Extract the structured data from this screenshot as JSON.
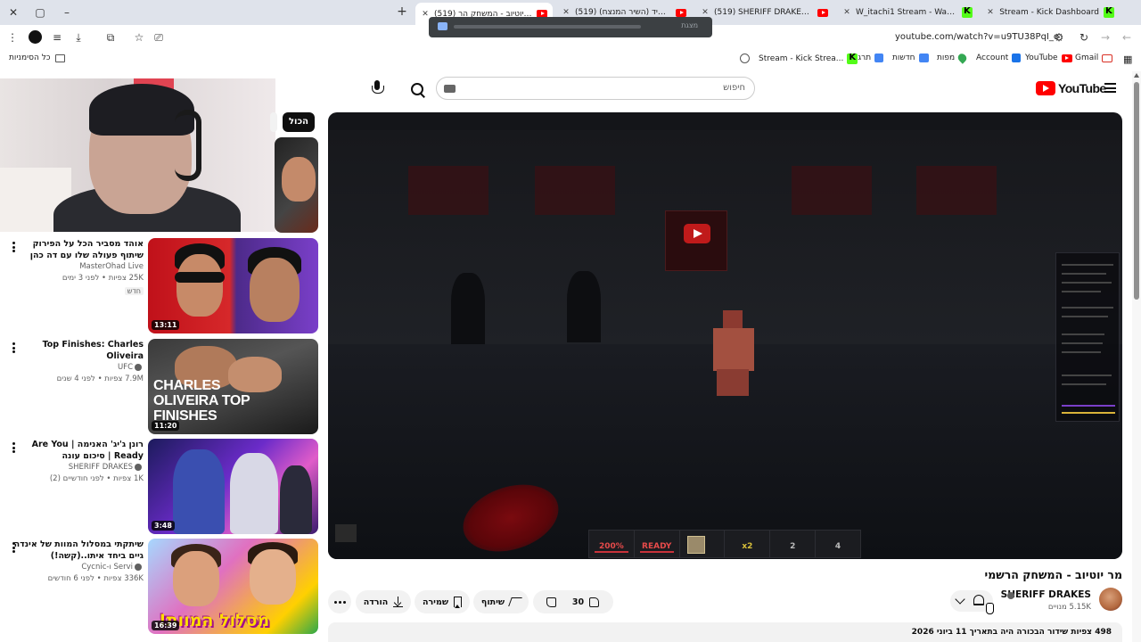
{
  "browser": {
    "tabs": [
      {
        "label": "Stream - Kick Dashboard",
        "favicon": "kick"
      },
      {
        "label": "W_itachi1 Stream - Watch Live",
        "favicon": "kick"
      },
      {
        "label": "(519) SHERIFF DRAKES - YouTube",
        "favicon": "youtube"
      },
      {
        "label": "(519) תפרוש מיד (השיר המנצח)",
        "favicon": "youtube"
      },
      {
        "label": "(519) מר יוטיוב - המשחק הר",
        "favicon": "youtube",
        "active": true
      }
    ],
    "url": "youtube.com/watch?v=u9TU38PqI_o",
    "popup_text": "מצגת"
  },
  "bookmarks": {
    "all_label": "כל הסימניות",
    "items": [
      {
        "label": "Gmail",
        "icon": "gmail-icon"
      },
      {
        "label": "YouTube",
        "icon": "youtube-icon"
      },
      {
        "label": "Account",
        "icon": "account-icon"
      },
      {
        "label": "מפות",
        "icon": "maps-icon"
      },
      {
        "label": "חדשות",
        "icon": "news-icon"
      },
      {
        "label": "תרגום",
        "icon": "translate-icon"
      },
      {
        "label": "Stream - Kick Strea...",
        "icon": "kick-icon"
      }
    ]
  },
  "youtube": {
    "logo_text": "YouTube",
    "search_placeholder": "חיפוש",
    "chips": [
      "הכול"
    ],
    "recommendations": [
      {
        "title": "אוהד מסביר הכל על הפירוק שיתוף פעולה שלו עם דה כהן",
        "channel": "MasterOhad Live",
        "stats": "25K צפיות • לפני 3 ימים",
        "badge": "חדש",
        "duration": "13:11"
      },
      {
        "title": "Top Finishes: Charles Oliveira",
        "channel": "UFC",
        "stats": "7.9M צפיות • לפני 4 שנים",
        "duration": "11:20",
        "thumb_text": "CHARLES OLIVEIRA TOP FINISHES"
      },
      {
        "title": "רונן ג'יג' האנימה | Are You Ready | סיכום עונה",
        "channel": "SHERIFF DRAKES",
        "stats": "1K צפיות • לפני חודשיים (2)",
        "duration": "3:48"
      },
      {
        "title": "שיתקתי במסלול המוות של אינדה גיים ביחד איתו..(קשה!)",
        "channel": "Servi ו-Cycnic",
        "stats": "336K צפיות • לפני 6 חודשים",
        "duration": "16:39",
        "thumb_text": "מסלול המוות!"
      }
    ],
    "video": {
      "title": "מר יוטיוב - המשחק הרשמי",
      "channel": "SHERIFF DRAKES",
      "subscribers": "5.15K מנויים",
      "likes": "30",
      "share_label": "שיתוף",
      "save_label": "שמירה",
      "download_label": "הורדה",
      "description_meta": "498 צפיות  שידור הבכורה היה בתאריך 11 ביוני 2026"
    },
    "game_hud": [
      "200%",
      "READY",
      "",
      "x2",
      "2",
      "4"
    ]
  },
  "colors": {
    "brand_red": "#ff0000",
    "kick_green": "#53fc18",
    "chip_dark": "#0f0f0f"
  }
}
